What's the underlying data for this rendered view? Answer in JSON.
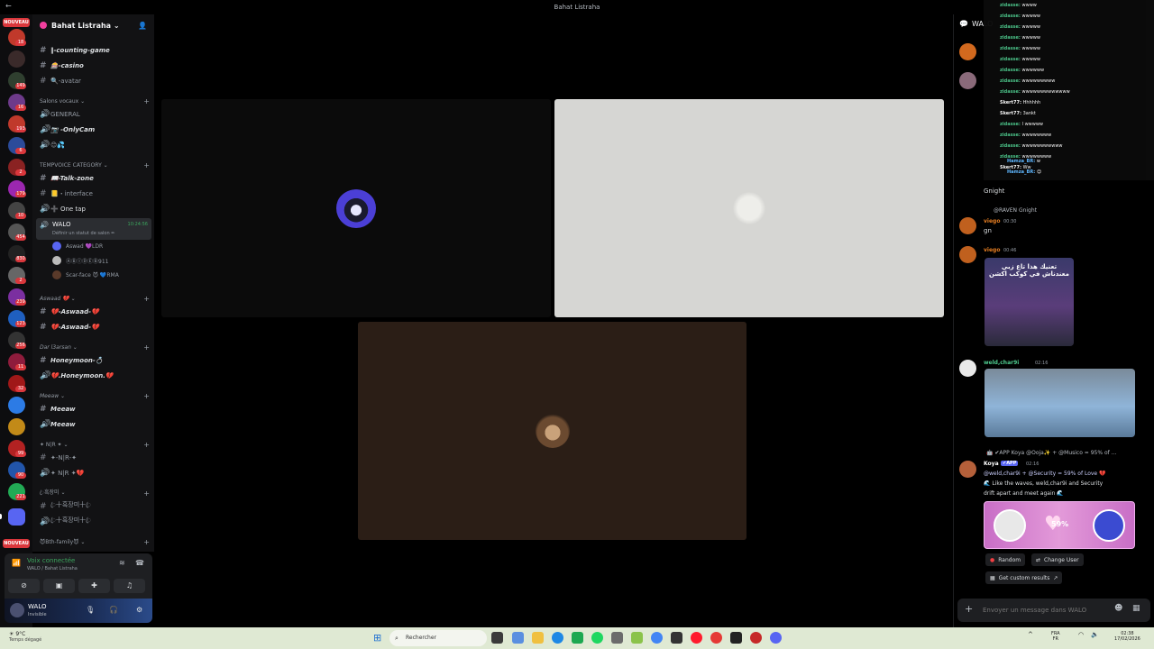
{
  "window": {
    "title": "Bahat Listraha"
  },
  "rail": {
    "new_label": "NOUVEAU",
    "badges": [
      "18",
      "149",
      "16",
      "193",
      "6",
      "2",
      "179",
      "10",
      "454",
      "830",
      "2",
      "239",
      "123",
      "256",
      "11",
      "32",
      "99",
      "90",
      "2",
      "221"
    ]
  },
  "guild": {
    "name": "Bahat Listraha ⌄"
  },
  "channels": {
    "items": [
      {
        "type": "text",
        "label": "‖-counting-game"
      },
      {
        "type": "text",
        "label": "🎰-casino"
      },
      {
        "type": "text",
        "label": "🔍-avatar"
      }
    ],
    "cat_voice": "Salons vocaux ⌄",
    "voice_items": [
      "GENERAL",
      "📷 -OnlyCam",
      "😊💦"
    ],
    "cat_temp": "TEMPVOICE CATEGORY ⌄",
    "temp_items": [
      "📖-Talk-zone",
      "📒・interface",
      "➕ One tap"
    ],
    "active_voice": {
      "name": "WALO",
      "time": "10:24:56",
      "status": "Définir un statut de salon ✏"
    },
    "voice_users": [
      "Aswad 💜LDR",
      "ⒶⒷⒾⒹⒺⒷ911",
      "Scar-face 😈 💙RMA"
    ],
    "cat_aswaad": "Aswaad 💔 ⌄",
    "aswaad_items": [
      "💔-Aswaad-💔",
      "💔-Aswaad-💔"
    ],
    "cat_dar": "Dar l3arsan ⌄",
    "dar_items": [
      "Honeymoon-💍",
      "💔.Honeymoon.💔"
    ],
    "cat_meeaw": "Meeaw ⌄",
    "meeaw_items": [
      "Meeaw",
      "Meeaw"
    ],
    "cat_nr": "✦ N|R ✦ ⌄",
    "nr_items": [
      "✦-N|R-✦",
      "✦ N|R ✦💔"
    ],
    "cat_kor": "ꦿ흑장미 ⌄",
    "kor_items": [
      "ꦿ十흑장미十ꦿ",
      "ꦿ十흑장미十ꦿ"
    ],
    "cat_family": "😈Bth-family😈 ⌄"
  },
  "voice_panel": {
    "title": "Voix connectée",
    "subtitle": "WALO / Bahat Listraha"
  },
  "user_panel": {
    "name": "WALO",
    "status": "Invisible"
  },
  "chat": {
    "channel": "WALO",
    "overlay_lines": [
      {
        "user": "zidasse:",
        "text": "wwww"
      },
      {
        "user": "zidasse:",
        "text": "wwwww"
      },
      {
        "user": "zidasse:",
        "text": "wwwww"
      },
      {
        "user": "zidasse:",
        "text": "wwwww"
      },
      {
        "user": "zidasse:",
        "text": "wwwww"
      },
      {
        "user": "zidasse:",
        "text": "wwwww"
      },
      {
        "user": "zidasse:",
        "text": "wwwwww"
      },
      {
        "user": "zidasse:",
        "text": "wwwwwwwww"
      },
      {
        "user": "zidasse:",
        "text": "wwwwwwwwwwwww"
      },
      {
        "user": "Skert77:",
        "text": "Hhhhhh"
      },
      {
        "user": "Skert77:",
        "text": "3ankt"
      },
      {
        "user": "zidasse:",
        "text": "I wwwww"
      },
      {
        "user": "zidasse:",
        "text": "wwwwwwww"
      },
      {
        "user": "zidasse:",
        "text": "wwwwwwwwwww"
      },
      {
        "user": "zidasse:",
        "text": "wwwwwwww"
      },
      {
        "user": "Skert77:",
        "text": "Ww"
      },
      {
        "user": "Hamza_BR:",
        "text": "w"
      },
      {
        "user": "Hamza_BR:",
        "text": "😊"
      }
    ],
    "msg_gnight": "Gnight",
    "reply_ref": "@RAVEN Gnight",
    "msg2_name": "viego",
    "msg2_time": "00:30",
    "msg2_text": "gn",
    "msg3_name": "viego",
    "msg3_time": "00:46",
    "msg3_image_text": "تعنيك هذا تاع زبي معندناش في كوكب اكشن",
    "msg4_name": "weld,char9i",
    "msg4_time": "02:16",
    "bot_reply": "🤖 ✔APP Koya @Ooja✨ + @Musico = 95% of ...",
    "bot_name": "Koya",
    "bot_tag": "✔APP",
    "bot_time": "02:16",
    "bot_line1": "@weld,char9i + @Security = 59% of Love 💔",
    "bot_line2": "🌊 Like the waves, weld,char9i and Security",
    "bot_line3": "drift apart and meet again 🌊",
    "love_percent": "59%",
    "btn_random": "Random",
    "btn_change": "Change User",
    "btn_custom": "Get custom results",
    "composer_placeholder": "Envoyer un message dans WALO"
  },
  "taskbar": {
    "temp": "9°C",
    "weather": "Temps dégagé",
    "search": "Rechercher",
    "lang": "FRA",
    "lang_sub": "FR",
    "time": "02:38",
    "date": "17/02/2026"
  },
  "colors": {
    "accent": "#5865f2",
    "online": "#23a55a",
    "danger": "#da373c",
    "love_card": "#d86fd0"
  }
}
